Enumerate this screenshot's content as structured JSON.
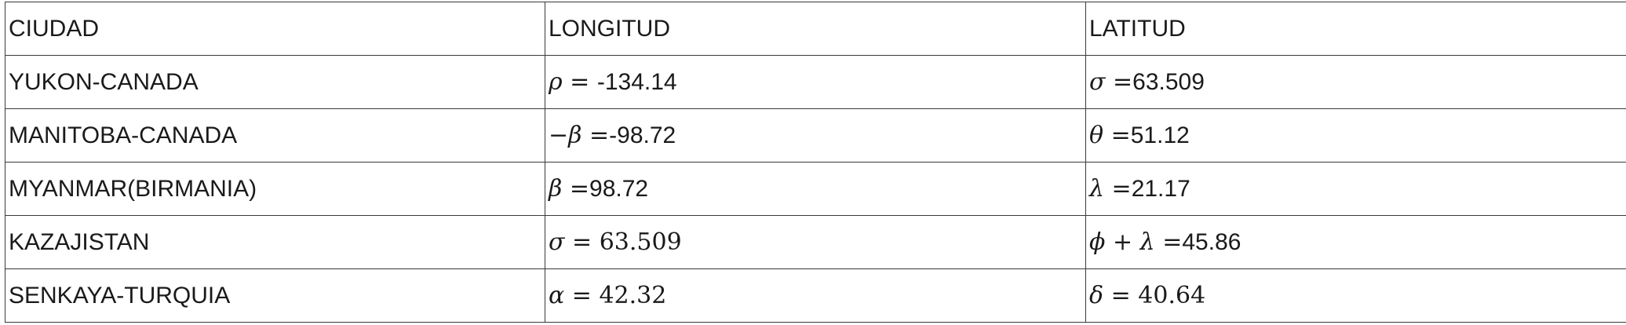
{
  "table": {
    "headers": [
      "CIUDAD",
      "LONGITUD",
      "LATITUD"
    ],
    "rows": [
      {
        "city": "YUKON-CANADA",
        "longitude": {
          "symbol": "ρ = ",
          "value": "-134.14"
        },
        "latitude": {
          "symbol": " σ =",
          "value": "63.509"
        }
      },
      {
        "city": "MANITOBA-CANADA",
        "longitude": {
          "symbol": "−β =",
          "value": "-98.72"
        },
        "latitude": {
          "symbol": "θ =",
          "value": "51.12"
        }
      },
      {
        "city": "MYANMAR(BIRMANIA)",
        "longitude": {
          "symbol": "β =",
          "value": "98.72"
        },
        "latitude": {
          "symbol": "λ =",
          "value": "21.17"
        }
      },
      {
        "city": "KAZAJISTAN",
        "longitude": {
          "symbol": "σ = ",
          "value": "63.509"
        },
        "latitude": {
          "symbol": "ϕ + λ =",
          "value": "45.86"
        }
      },
      {
        "city": "SENKAYA-TURQUIA",
        "longitude": {
          "symbol": "α = ",
          "value": "42.32"
        },
        "latitude": {
          "symbol": "δ = ",
          "value": "40.64"
        }
      }
    ]
  }
}
